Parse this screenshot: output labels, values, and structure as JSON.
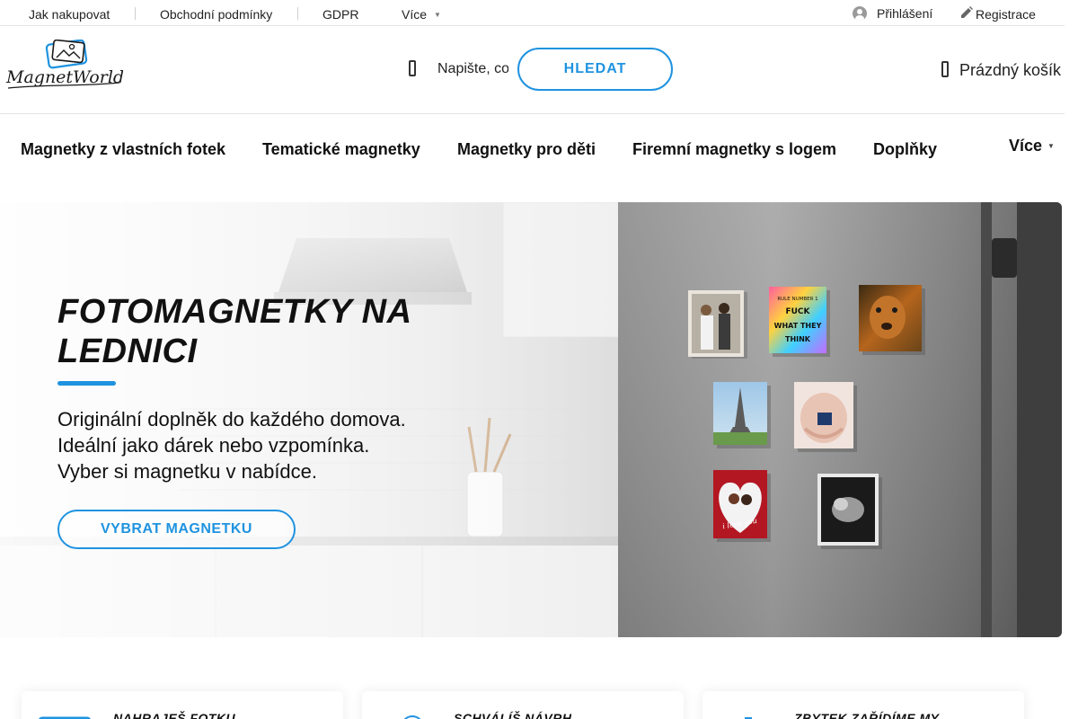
{
  "topbar": {
    "links": [
      "Jak nakupovat",
      "Obchodní podmínky",
      "GDPR"
    ],
    "more_label": "Více",
    "login_label": "Přihlášení",
    "register_label": "Registrace"
  },
  "header": {
    "logo_text": "MagnetWorld",
    "search_placeholder": "Napište, co hledáte",
    "search_button": "HLEDAT",
    "cart_label": "Prázdný košík"
  },
  "nav": {
    "items": [
      "Magnetky z vlastních fotek",
      "Tematické magnetky",
      "Magnetky pro děti",
      "Firemní magnetky s logem",
      "Doplňky"
    ],
    "more_label": "Více"
  },
  "hero": {
    "title_line1": "FOTOMAGNETKY NA",
    "title_line2": "LEDNICI",
    "subtitle_lines": [
      "Originální doplněk do každého domova.",
      "Ideální jako dárek nebo vzpomínka.",
      "Vyber si magnetku v nabídce."
    ],
    "cta_label": "VYBRAT MAGNETKU",
    "magnet_quote": [
      "RULE NUMBER 1",
      "FUCK",
      "WHAT THEY",
      "THINK"
    ],
    "magnet_love_text": "i love you"
  },
  "steps": [
    {
      "title": "NAHRAJEŠ FOTKU",
      "icon": "upload-photo-icon"
    },
    {
      "title": "SCHVÁLÍŠ NÁVRH",
      "icon": "check-circle-icon"
    },
    {
      "title": "ZBYTEK ZAŘÍDÍME MY",
      "icon": "delivery-icon"
    }
  ],
  "colors": {
    "accent": "#1f93e0",
    "text": "#111111"
  }
}
